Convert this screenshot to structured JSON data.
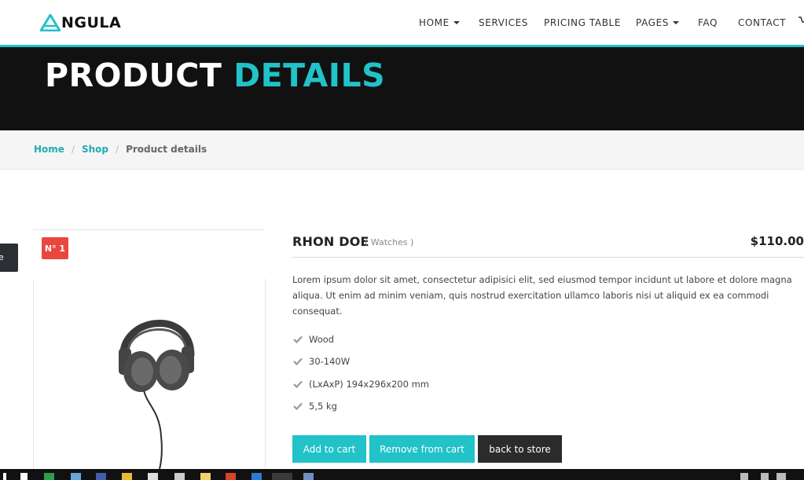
{
  "brand": {
    "logo_text": "NGULA",
    "accent": "#21c2c8"
  },
  "nav": {
    "items": [
      {
        "label": "HOME",
        "dropdown": true
      },
      {
        "label": "SERVICES",
        "dropdown": false
      },
      {
        "label": "PRICING TABLE",
        "dropdown": false
      },
      {
        "label": "PAGES",
        "dropdown": true
      },
      {
        "label": "FAQ",
        "dropdown": false
      },
      {
        "label": "CONTACT",
        "dropdown": false
      }
    ]
  },
  "hero": {
    "title_main": "PRODUCT",
    "title_accent": "DETAILS"
  },
  "breadcrumb": {
    "home": "Home",
    "sep": "/",
    "shop": "Shop",
    "current": "Product details"
  },
  "side_tab": {
    "label": "e"
  },
  "badge": {
    "label": "N° 1"
  },
  "product": {
    "name": "RHON DOE",
    "category": "( Watches )",
    "price": "$110.00",
    "description": "Lorem ipsum dolor sit amet, consectetur adipisici elit, sed eiusmod tempor incidunt ut labore et dolore magna aliqua. Ut enim ad minim veniam, quis nostrud exercitation ullamco laboris nisi ut aliquid ex ea commodi consequat.",
    "features": [
      "Wood",
      "30-140W",
      "(LxAxP) 194x296x200 mm",
      "5,5 kg"
    ]
  },
  "buttons": {
    "add": "Add to cart",
    "remove": "Remove from cart",
    "back": "back to store"
  },
  "taskbar": {
    "icons": [
      "start-icon",
      "search-icon",
      "app-icon",
      "file-explorer-icon",
      "folder-icon",
      "calculator-icon",
      "photos-icon",
      "notes-icon",
      "powerpoint-icon",
      "vscode-icon",
      "chrome-icon",
      "app-icon"
    ]
  }
}
